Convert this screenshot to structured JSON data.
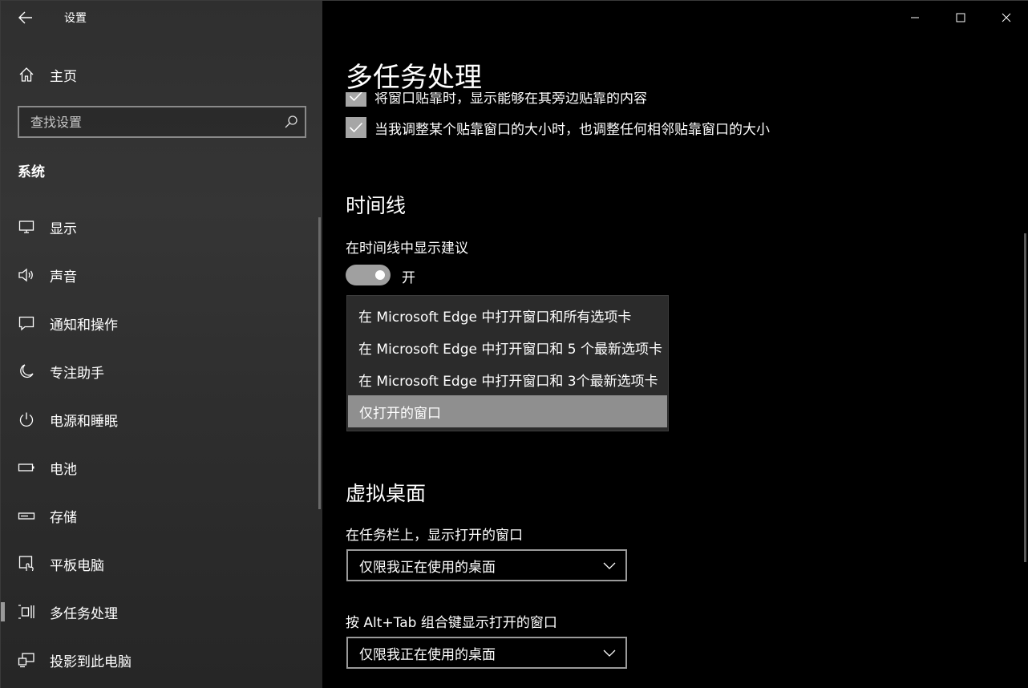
{
  "app": {
    "title": "设置"
  },
  "sidebar": {
    "home_label": "主页",
    "search_placeholder": "查找设置",
    "section_label": "系统",
    "items": [
      {
        "label": "显示",
        "icon": "monitor-icon"
      },
      {
        "label": "声音",
        "icon": "speaker-icon"
      },
      {
        "label": "通知和操作",
        "icon": "message-icon"
      },
      {
        "label": "专注助手",
        "icon": "moon-icon"
      },
      {
        "label": "电源和睡眠",
        "icon": "power-icon"
      },
      {
        "label": "电池",
        "icon": "battery-icon"
      },
      {
        "label": "存储",
        "icon": "storage-icon"
      },
      {
        "label": "平板电脑",
        "icon": "tablet-icon"
      },
      {
        "label": "多任务处理",
        "icon": "multitask-icon",
        "active": true
      },
      {
        "label": "投影到此电脑",
        "icon": "project-icon"
      }
    ]
  },
  "main": {
    "title": "多任务处理",
    "snap": {
      "cutoff_option": "将窗口贴靠时，显示能够在其旁边贴靠的内容",
      "resize_option": "当我调整某个贴靠窗口的大小时，也调整任何相邻贴靠窗口的大小"
    },
    "timeline": {
      "heading": "时间线",
      "suggestions_label": "在时间线中显示建议",
      "toggle_state": "开",
      "dropdown_options": [
        "在 Microsoft Edge 中打开窗口和所有选项卡",
        "在 Microsoft Edge 中打开窗口和 5 个最新选项卡",
        "在 Microsoft Edge 中打开窗口和 3个最新选项卡",
        "仅打开的窗口"
      ],
      "selected_option": "仅打开的窗口"
    },
    "virtual_desktops": {
      "heading": "虚拟桌面",
      "taskbar_label": "在任务栏上，显示打开的窗口",
      "taskbar_value": "仅限我正在使用的桌面",
      "alttab_label": "按 Alt+Tab 组合键显示打开的窗口",
      "alttab_value": "仅限我正在使用的桌面"
    }
  },
  "colors": {
    "toggle_on": "#a0a0a0",
    "checkbox": "#a6a6a6",
    "selected_option": "#8f8f8f"
  }
}
